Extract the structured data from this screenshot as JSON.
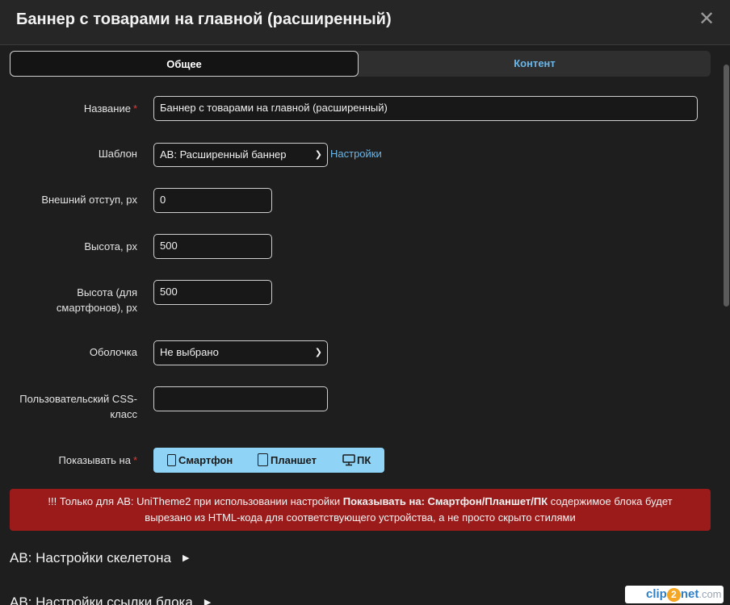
{
  "modal": {
    "title": "Баннер с товарами на главной (расширенный)",
    "close_glyph": "✕"
  },
  "tabs": [
    {
      "label": "Общее",
      "active": true
    },
    {
      "label": "Контент",
      "active": false
    }
  ],
  "form": {
    "name": {
      "label": "Название",
      "required": "*",
      "value": "Баннер с товарами на главной (расширенный)"
    },
    "template": {
      "label": "Шаблон",
      "value": "АВ: Расширенный баннер",
      "settings_link": "Настройки"
    },
    "margin": {
      "label": "Внешний отступ, px",
      "value": "0"
    },
    "height": {
      "label": "Высота, px",
      "value": "500"
    },
    "height_mobile": {
      "label_line1": "Высота (для",
      "label_line2": "смартфонов), px",
      "value": "500"
    },
    "wrapper": {
      "label": "Оболочка",
      "value": "Не выбрано"
    },
    "css_class": {
      "label_line1": "Пользовательский CSS-",
      "label_line2": "класс",
      "value": ""
    },
    "show_on": {
      "label": "Показывать на",
      "required": "*",
      "devices": [
        "Смартфон",
        "Планшет",
        "ПК"
      ]
    }
  },
  "alert": {
    "prefix": "!!! Только для АВ: UniTheme2 при использовании настройки ",
    "bold": "Показывать на: Смартфон/Планшет/ПК",
    "suffix_line1": " содержимое блока будет",
    "line2": "вырезано из HTML-кода для соответствующего устройства, а не просто скрыто стилями"
  },
  "sections": [
    {
      "label": "АВ: Настройки скелетона"
    },
    {
      "label": "АВ: Настройки ссылки блока"
    }
  ],
  "watermark": {
    "part1": "clip",
    "part2": "2",
    "part3": "net",
    "part4": ".com"
  },
  "colors": {
    "accent_link": "#6bb6e8",
    "alert_bg": "#9b1b1b",
    "device_bg": "#8fd3f6",
    "required": "#e03b3b"
  }
}
